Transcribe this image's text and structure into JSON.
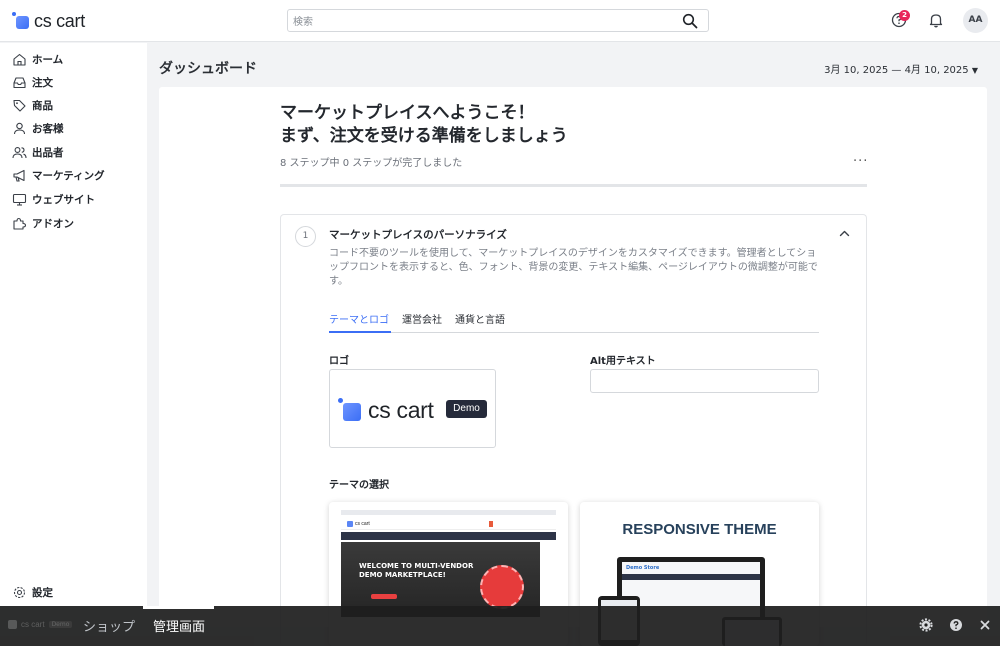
{
  "app": {
    "logo_text": "cs cart"
  },
  "header": {
    "search_placeholder": "検索",
    "notification_count": "2",
    "avatar_initials": "AA"
  },
  "sidebar": {
    "items": [
      {
        "label": "ホーム",
        "icon": "home-icon"
      },
      {
        "label": "注文",
        "icon": "inbox-icon"
      },
      {
        "label": "商品",
        "icon": "tag-icon"
      },
      {
        "label": "お客様",
        "icon": "user-icon"
      },
      {
        "label": "出品者",
        "icon": "users-icon"
      },
      {
        "label": "マーケティング",
        "icon": "megaphone-icon"
      },
      {
        "label": "ウェブサイト",
        "icon": "monitor-icon"
      },
      {
        "label": "アドオン",
        "icon": "puzzle-icon"
      }
    ],
    "settings_label": "設定"
  },
  "main": {
    "page_title": "ダッシュボード",
    "date_range": "3月 10, 2025 — 4月 10, 2025",
    "welcome_line1": "マーケットプレイスへようこそ！",
    "welcome_line2": "まず、注文を受ける準備をしましょう",
    "steps_text": "8 ステップ中 0 ステップが完了しました",
    "progress_percent": 0,
    "more_label": "···"
  },
  "step": {
    "number": "1",
    "title": "マーケットプレイスのパーソナライズ",
    "description": "コード不要のツールを使用して、マーケットプレイスのデザインをカスタマイズできます。管理者としてショップフロントを表示すると、色、フォント、背景の変更、テキスト編集、ページレイアウトの微調整が可能です。",
    "tabs": [
      "テーマとロゴ",
      "運営会社",
      "通貨と言語"
    ],
    "active_tab": 0,
    "logo_label": "ロゴ",
    "logo_text": "cs cart",
    "demo_label": "Demo",
    "alt_label": "Alt用テキスト",
    "alt_value": "",
    "theme_label": "テーマの選択",
    "theme1": {
      "headline1": "WELCOME TO MULTI-VENDOR",
      "headline2": "DEMO MARKETPLACE!"
    },
    "theme2": {
      "title": "RESPONSIVE THEME",
      "store_label": "Demo Store"
    }
  },
  "bottom_bar": {
    "logo_text": "cs cart",
    "demo_label": "Demo",
    "tabs": [
      "ショップ",
      "管理画面"
    ],
    "active_tab": 1
  },
  "colors": {
    "accent": "#3b6ef5",
    "badge": "#e8255a",
    "bottom_bar": "#1e1e1e"
  }
}
